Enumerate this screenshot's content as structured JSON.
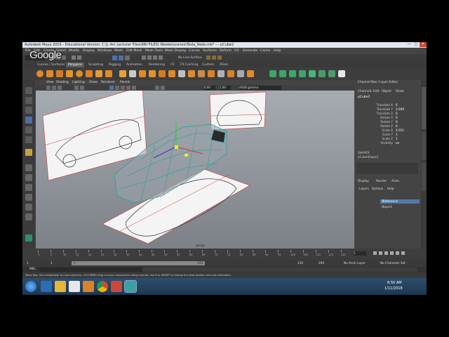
{
  "window": {
    "title": "Autodesk Maya 2016 - Educational Version: C:\\L Am Lecturer Files\\ANI FILES\\ Weebe\\scenes\\Tesla_Redo.mb* --- pCube2",
    "min": "—",
    "max": "□",
    "close": "✕"
  },
  "overlay": {
    "logo": "Google"
  },
  "menubar": [
    "File",
    "Edit",
    "Create",
    "Select",
    "Modify",
    "Display",
    "Windows",
    "Mesh",
    "Edit Mesh",
    "Mesh Tools",
    "Mesh Display",
    "Curves",
    "Surfaces",
    "Deform",
    "UV",
    "Generate",
    "Cache",
    "Help"
  ],
  "statusline": {
    "workspace": "No Live Surface"
  },
  "shelf_tabs": [
    "Curves / Surfaces",
    "Polygons",
    "Sculpting",
    "Rigging",
    "Animation",
    "Rendering",
    "FX",
    "FX Caching",
    "Custom",
    "XGen"
  ],
  "shelf_active": "Polygons",
  "viewport": {
    "menu": [
      "View",
      "Shading",
      "Lighting",
      "Show",
      "Renderer",
      "Panels"
    ],
    "value_a": "0.00",
    "value_b": "1.00",
    "colorspace": "sRGB gamma",
    "camera_label": "persp"
  },
  "channel_box": {
    "tabs": [
      "Channels",
      "Edit",
      "Object",
      "Show"
    ],
    "object": "pCube2",
    "attributes": [
      {
        "name": "Translate X",
        "value": "0"
      },
      {
        "name": "Translate Y",
        "value": "2.609"
      },
      {
        "name": "Translate Z",
        "value": "0"
      },
      {
        "name": "Rotate X",
        "value": "0"
      },
      {
        "name": "Rotate Y",
        "value": "0"
      },
      {
        "name": "Rotate Z",
        "value": "0"
      },
      {
        "name": "Scale X",
        "value": "2.011"
      },
      {
        "name": "Scale Y",
        "value": "1"
      },
      {
        "name": "Scale Z",
        "value": "1"
      },
      {
        "name": "Visibility",
        "value": "on"
      }
    ],
    "shapes_header": "SHAPES",
    "shape": "pCubeShape2"
  },
  "layer_editor": {
    "tabs": [
      "Display",
      "Render",
      "Anim"
    ],
    "menu": [
      "Layers",
      "Options",
      "Help"
    ],
    "layers": [
      {
        "name": "Reference",
        "state": "V"
      },
      {
        "name": "layer1",
        "state": "V"
      }
    ]
  },
  "right_tabs": [
    "Channel Box / Layer Editor",
    "Attribute Editor",
    "Modeling Toolkit"
  ],
  "timeline": {
    "ticks": [
      "1",
      "5",
      "10",
      "15",
      "20",
      "25",
      "30",
      "35",
      "40",
      "45",
      "50",
      "55",
      "60",
      "65",
      "70",
      "75",
      "80",
      "85",
      "90",
      "95",
      "100",
      "105",
      "110",
      "115",
      "120"
    ],
    "current_frame": "1"
  },
  "range": {
    "start": "1",
    "start_inner": "1",
    "end_inner": "120",
    "end": "120",
    "end_outer": "200",
    "anim_layer": "No Anim Layer",
    "character": "No Character Set"
  },
  "cmdline": {
    "label": "MEL"
  },
  "helpline": {
    "text": "Move Tool: Use manipulator to move object(s). Ctrl+MMB+drag to move components along normals. Use D or INSERT to change the pivot position and axis orientation."
  },
  "taskbar": {
    "time": "8:50 AM",
    "date": "1/11/2018"
  }
}
